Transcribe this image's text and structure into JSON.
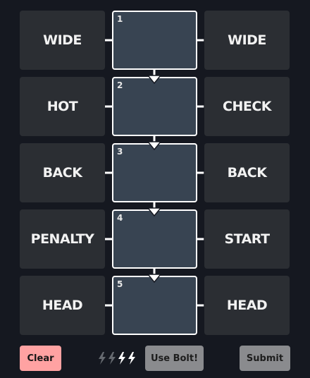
{
  "rows": [
    {
      "left": "WIDE",
      "slot_number": "1",
      "right": "WIDE"
    },
    {
      "left": "HOT",
      "slot_number": "2",
      "right": "CHECK"
    },
    {
      "left": "BACK",
      "slot_number": "3",
      "right": "BACK"
    },
    {
      "left": "PENALTY",
      "slot_number": "4",
      "right": "START"
    },
    {
      "left": "HEAD",
      "slot_number": "5",
      "right": "HEAD"
    }
  ],
  "controls": {
    "clear_label": "Clear",
    "bolt_label": "Use Bolt!",
    "submit_label": "Submit"
  },
  "bolts": {
    "icon": "lightning-bolt-icon",
    "total": 4,
    "used": 2
  },
  "colors": {
    "background": "#151820",
    "tile": "#2b2e33",
    "slot_fill": "#384452",
    "slot_border": "#ffffff",
    "clear_button": "#ffa2a2",
    "disabled_button": "#8a8b8e",
    "bolt_used": "#666a70",
    "bolt_available": "#ffffff"
  }
}
